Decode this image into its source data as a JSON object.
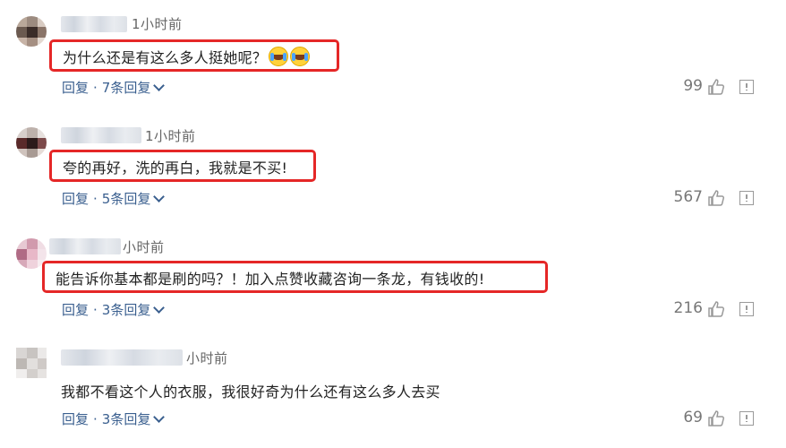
{
  "comments": [
    {
      "time": "1小时前",
      "text": "为什么还是有这么多人挺她呢？",
      "emoji": [
        "crying-laughing-emoji",
        "crying-laughing-emoji"
      ],
      "reply_label": "回复",
      "replies_label": "7条回复",
      "likes": "99",
      "highlighted": true
    },
    {
      "time": "1小时前",
      "text": "夸的再好，洗的再白，我就是不买!",
      "reply_label": "回复",
      "replies_label": "5条回复",
      "likes": "567",
      "highlighted": true
    },
    {
      "time": "小时前",
      "text": "能告诉你基本都是刷的吗？！加入点赞收藏咨询一条龙，有钱收的!",
      "reply_label": "回复",
      "replies_label": "3条回复",
      "likes": "216",
      "highlighted": true
    },
    {
      "time": "小时前",
      "text": "我都不看这个人的衣服，我很好奇为什么还有这么多人去买",
      "reply_label": "回复",
      "replies_label": "3条回复",
      "likes": "69",
      "highlighted": false
    }
  ],
  "colors": {
    "highlight_border": "#e52727",
    "action_link": "#3a5f8f",
    "muted_text": "#666666"
  },
  "icons": [
    "thumbs-up-icon",
    "report-icon",
    "chevron-down-icon"
  ]
}
